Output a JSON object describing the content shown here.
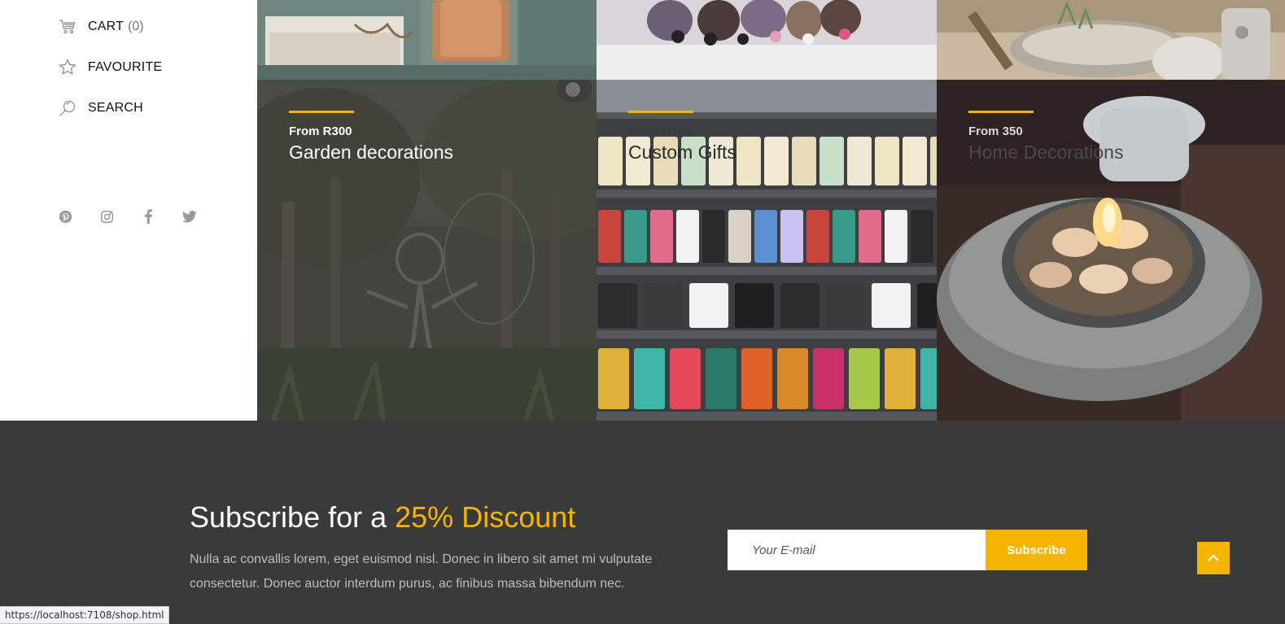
{
  "sidebar": {
    "cart_label": "CART",
    "cart_count": "(0)",
    "favourite_label": "FAVOURITE",
    "search_label": "SEARCH",
    "socials": [
      "pinterest-icon",
      "instagram-icon",
      "facebook-icon",
      "twitter-icon"
    ]
  },
  "tiles": [
    {
      "price": "From R300",
      "name": "Garden decorations"
    },
    {
      "price": "From R100",
      "name": "Custom Gifts"
    },
    {
      "price": "From 350",
      "name": "Home Decorations"
    }
  ],
  "footer": {
    "title_prefix": "Subscribe for a",
    "title_accent": "25% Discount",
    "text": "Nulla ac convallis lorem, eget euismod nisl. Donec in libero sit amet mi vulputate consectetur. Donec auctor interdum purus, ac finibus massa bibendum nec.",
    "email_placeholder": "Your E-mail",
    "subscribe_label": "Subscribe"
  },
  "status_bar": {
    "url": "https://localhost:7108/shop.html"
  },
  "colors": {
    "accent": "#f5b400",
    "footer_bg": "#3a3a3a"
  }
}
